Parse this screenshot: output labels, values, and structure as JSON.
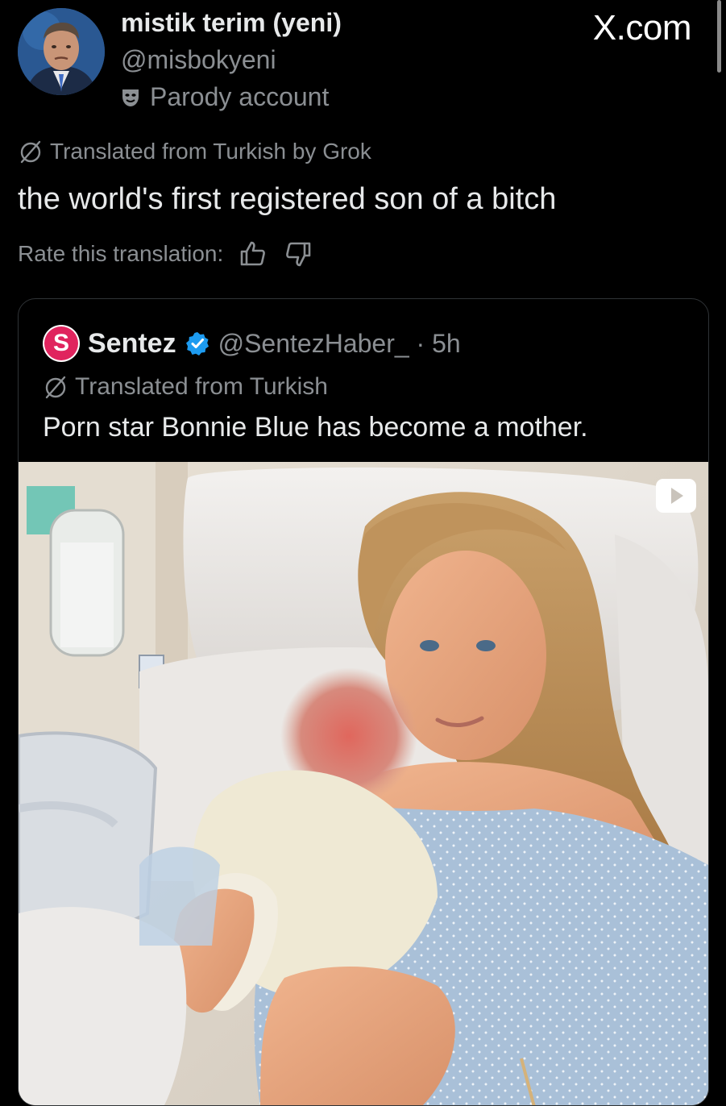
{
  "site": {
    "label": "X.com"
  },
  "author": {
    "name": "mistik terim (yeni)",
    "handle": "@misbokyeni",
    "badge_label": "Parody account",
    "badge_icon": "parody-mask-icon"
  },
  "post": {
    "translation_label": "Translated from Turkish by Grok",
    "translation_icon": "globe-slash-icon",
    "text": "the world's first registered son of a bitch",
    "rate_label": "Rate this translation:",
    "rate_icons": [
      "thumbs-up-icon",
      "thumbs-down-icon"
    ]
  },
  "quoted": {
    "name": "Sentez",
    "logo_letter": "S",
    "verified_icon": "verified-badge-icon",
    "handle_time": "@SentezHaber_ · 5h",
    "translation_label": "Translated from Turkish",
    "text": "Porn star Bonnie Blue has become a mother.",
    "media": {
      "video_icon": "play-icon"
    }
  },
  "colors": {
    "background": "#000000",
    "text_primary": "#e7e9ea",
    "text_secondary": "#8b8f93",
    "border": "#2f3336",
    "verified": "#1d9bf0",
    "sentez_brand": "#e0245e"
  }
}
